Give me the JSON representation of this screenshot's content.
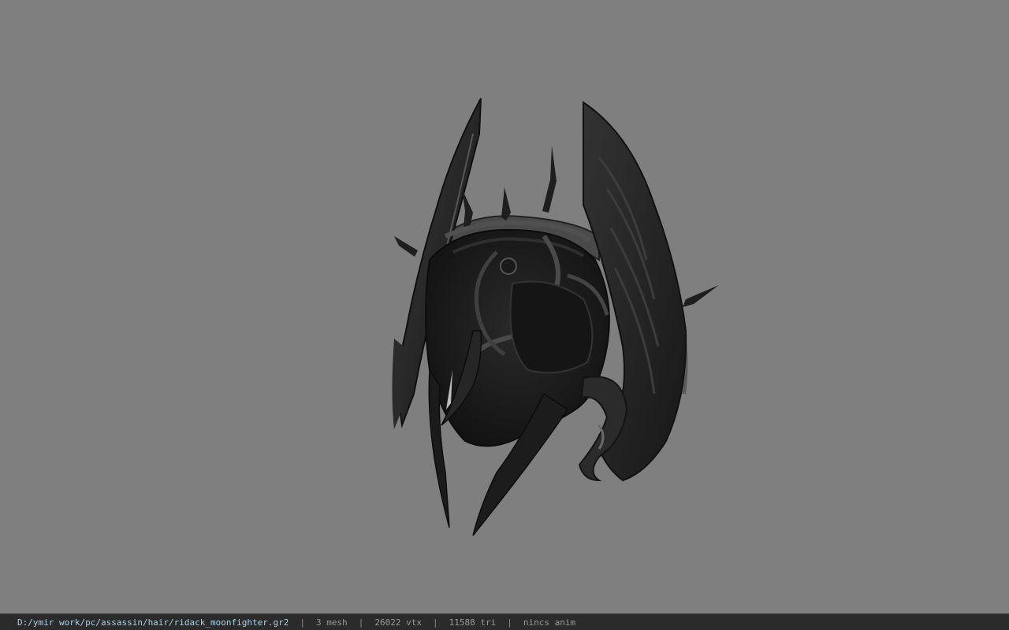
{
  "statusbar": {
    "file_path": "D:/ymir work/pc/assassin/hair/ridack_moonfighter.gr2",
    "separator": "|",
    "mesh_count": "3 mesh",
    "vertex_count": "26022 vtx",
    "triangle_count": "11588 tri",
    "anim_status": "nincs anim"
  },
  "colors": {
    "viewport_background": "#7f7f7f",
    "statusbar_background": "#2b2b2b",
    "path_text": "#a8d4e6",
    "stat_text": "#9a9a9a"
  },
  "icons": {
    "model": "helmet-model-icon"
  }
}
